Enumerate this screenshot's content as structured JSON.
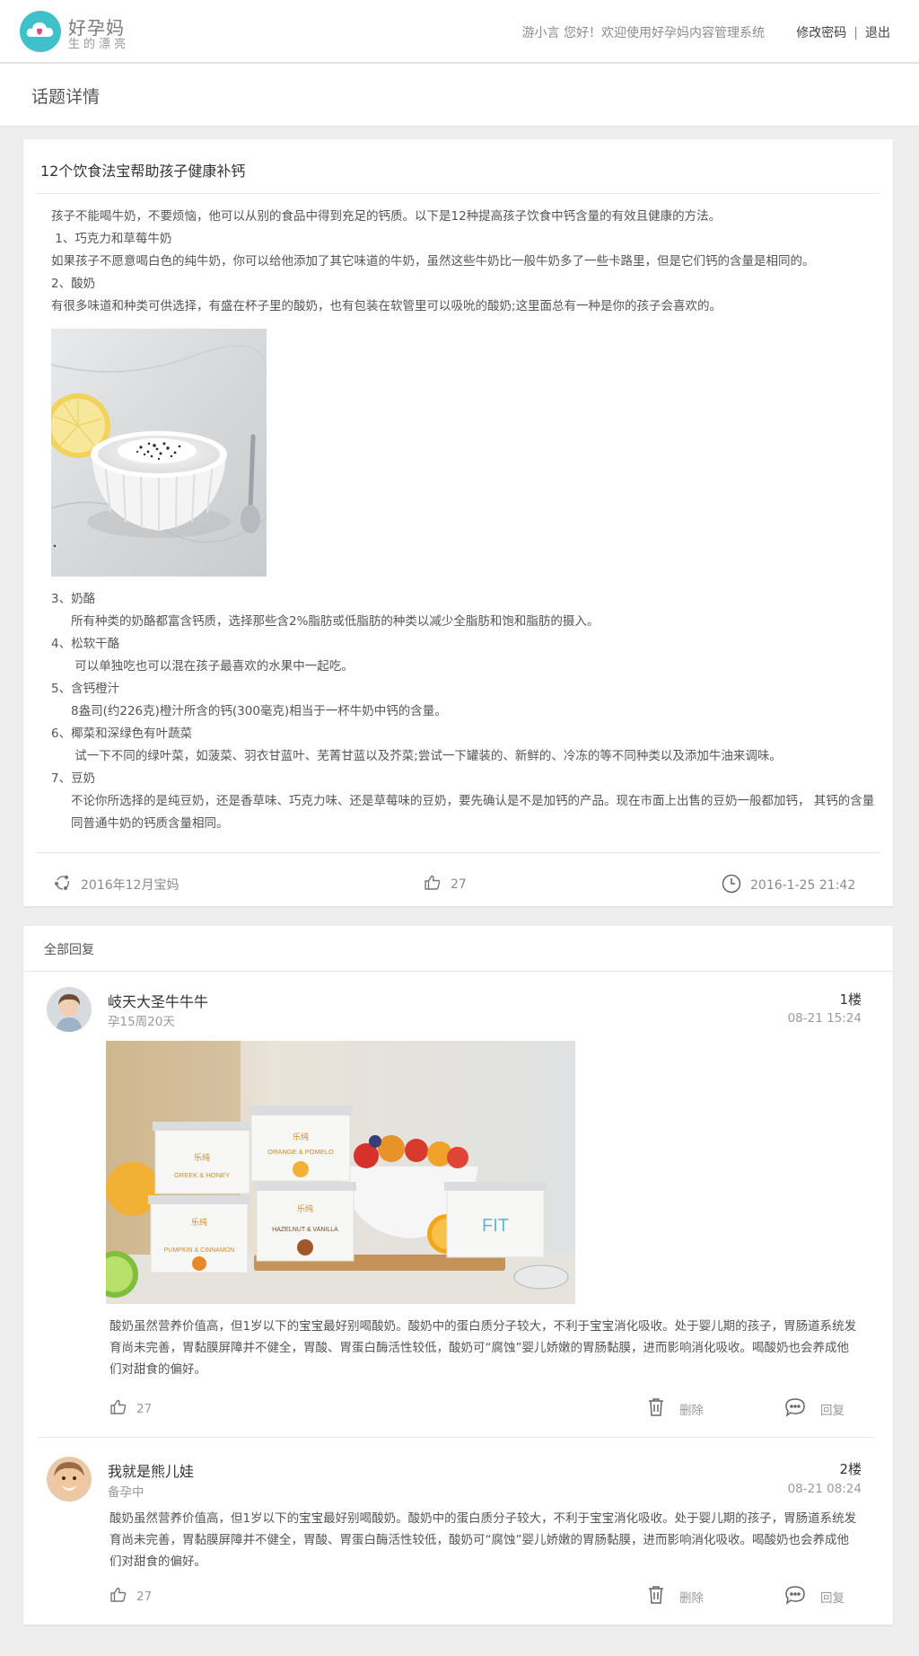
{
  "header": {
    "brand_title": "好孕妈",
    "brand_sub": "生的漂亮",
    "welcome": "游小言 您好！欢迎使用好孕妈内容管理系统",
    "change_password": "修改密码",
    "separator": "|",
    "logout": "退出"
  },
  "page": {
    "title": "话题详情"
  },
  "article": {
    "title": "12个饮食法宝帮助孩子健康补钙",
    "lines": [
      "孩子不能喝牛奶，不要烦恼，他可以从别的食品中得到充足的钙质。以下是12种提高孩子饮食中钙含量的有效且健康的方法。",
      " 1、巧克力和草莓牛奶",
      "如果孩子不愿意喝白色的纯牛奶，你可以给他添加了其它味道的牛奶，虽然这些牛奶比一般牛奶多了一些卡路里，但是它们钙的含量是相同的。",
      "2、酸奶",
      "有很多味道和种类可供选择，有盛在杯子里的酸奶，也有包装在软管里可以吸吮的酸奶;这里面总有一种是你的孩子会喜欢的。"
    ],
    "lines2": [
      "3、奶酪",
      "所有种类的奶酪都富含钙质，选择那些含2%脂肪或低脂肪的种类以减少全脂肪和饱和脂肪的摄入。",
      "4、松软干酪",
      " 可以单独吃也可以混在孩子最喜欢的水果中一起吃。",
      "5、含钙橙汁",
      "8盎司(约226克)橙汁所含的钙(300毫克)相当于一杯牛奶中钙的含量。",
      "6、椰菜和深绿色有叶蔬菜",
      " 试一下不同的绿叶菜，如菠菜、羽衣甘蓝叶、芜菁甘蓝以及芥菜;尝试一下罐装的、新鲜的、冷冻的等不同种类以及添加牛油来调味。",
      "7、豆奶",
      "不论你所选择的是纯豆奶，还是香草味、巧克力味、还是草莓味的豆奶，要先确认是不是加钙的产品。现在市面上出售的豆奶一般都加钙， 其钙的含量同普通牛奶的钙质含量相同。"
    ],
    "group": "2016年12月宝妈",
    "likes": "27",
    "datetime": "2016-1-25 21:42"
  },
  "replies": {
    "heading": "全部回复",
    "items": [
      {
        "name": "岐天大圣牛牛牛",
        "status": "孕15周20天",
        "floor": "1楼",
        "time": "08-21 15:24",
        "text": "酸奶虽然营养价值高，但1岁以下的宝宝最好别喝酸奶。酸奶中的蛋白质分子较大，不利于宝宝消化吸收。处于婴儿期的孩子，胃肠道系统发育尚未完善，胃黏膜屏障并不健全，胃酸、胃蛋白酶活性较低，酸奶可“腐蚀”婴儿娇嫩的胃肠黏膜，进而影响消化吸收。喝酸奶也会养成他们对甜食的偏好。",
        "likes": "27",
        "delete": "删除",
        "reply": "回复",
        "product_labels": [
          "乐纯",
          "GREEK & HONEY",
          "ORANGE & POMELO",
          "PUMPKIN & CINNAMON",
          "HAZELNUT & VANILLA",
          "FIT"
        ]
      },
      {
        "name": "我就是熊儿娃",
        "status": "备孕中",
        "floor": "2楼",
        "time": "08-21 08:24",
        "text": "酸奶虽然营养价值高，但1岁以下的宝宝最好别喝酸奶。酸奶中的蛋白质分子较大，不利于宝宝消化吸收。处于婴儿期的孩子，胃肠道系统发育尚未完善，胃黏膜屏障并不健全，胃酸、胃蛋白酶活性较低，酸奶可“腐蚀”婴儿娇嫩的胃肠黏膜，进而影响消化吸收。喝酸奶也会养成他们对甜食的偏好。",
        "likes": "27",
        "delete": "删除",
        "reply": "回复"
      }
    ]
  },
  "colors": {
    "brand": "#3ec1c9",
    "brand_heart": "#e6447a",
    "text_muted": "#9a9a9a"
  },
  "icons": [
    "logo-cloud-icon",
    "group-cycle-icon",
    "thumbs-up-icon",
    "clock-icon",
    "trash-icon",
    "chat-bubble-icon"
  ]
}
